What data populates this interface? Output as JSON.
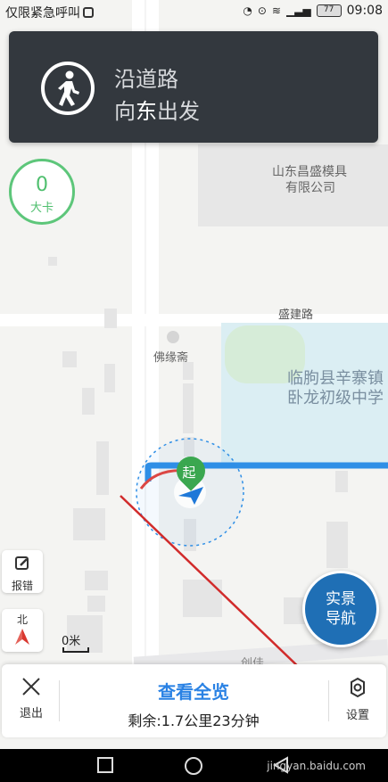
{
  "status_bar": {
    "carrier_text": "仅限紧急呼叫",
    "battery": "77",
    "time": "09:08"
  },
  "map": {
    "labels": {
      "company_line1": "山东昌盛模具",
      "company_line2": "有限公司",
      "road_north": "盛建路",
      "poi_temple": "佛缘斋",
      "school_line1": "临朐县辛寨镇",
      "school_line2": "卧龙初级中学",
      "start_marker": "起",
      "road_bottom": "创佳"
    }
  },
  "nav_card": {
    "road": "沿道路",
    "direction_prefix": "向",
    "direction_highlight": "东",
    "direction_suffix": "出发",
    "icon": "pedestrian-icon"
  },
  "speed": {
    "value": "0",
    "unit": "大卡"
  },
  "controls": {
    "report_label": "报错",
    "north_label": "北",
    "scale_label": "0米",
    "ar_nav_line1": "实景",
    "ar_nav_line2": "导航"
  },
  "bottom_panel": {
    "exit_label": "退出",
    "overview_label": "查看全览",
    "remaining": "剩余:1.7公里23分钟",
    "settings_label": "设置"
  },
  "colors": {
    "route_blue": "#2f8fe6",
    "card_bg": "#33383e",
    "accent_green": "#4fbf6e",
    "link_blue": "#2a82e4"
  },
  "watermark": "jingyan.baidu.com"
}
